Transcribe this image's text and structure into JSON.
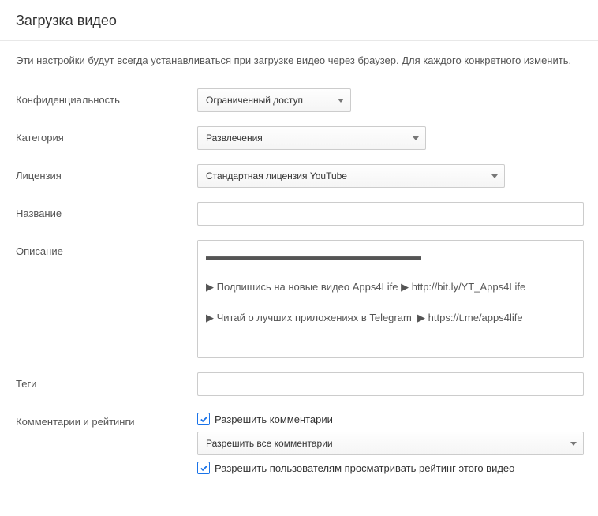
{
  "header": {
    "title": "Загрузка видео"
  },
  "intro_text": "Эти настройки будут всегда устанавливаться при загрузке видео через браузер. Для каждого конкретного изменить.",
  "fields": {
    "privacy": {
      "label": "Конфиденциальность",
      "value": "Ограниченный доступ"
    },
    "category": {
      "label": "Категория",
      "value": "Развлечения"
    },
    "license": {
      "label": "Лицензия",
      "value": "Стандартная лицензия YouTube"
    },
    "title": {
      "label": "Название",
      "value": ""
    },
    "description": {
      "label": "Описание",
      "value": "▬▬▬▬▬▬▬▬▬▬▬▬▬▬▬▬▬▬▬▬▬\n\n▶ Подпишись на новые видео Apps4Life ▶ http://bit.ly/YT_Apps4Life\n\n▶ Читай о лучших приложениях в Telegram  ▶ https://t.me/apps4life"
    },
    "tags": {
      "label": "Теги",
      "value": ""
    },
    "comments": {
      "label": "Комментарии и рейтинги",
      "allow_comments_label": "Разрешить комментарии",
      "comments_mode_value": "Разрешить все комментарии",
      "allow_rating_label": "Разрешить пользователям просматривать рейтинг этого видео"
    }
  }
}
